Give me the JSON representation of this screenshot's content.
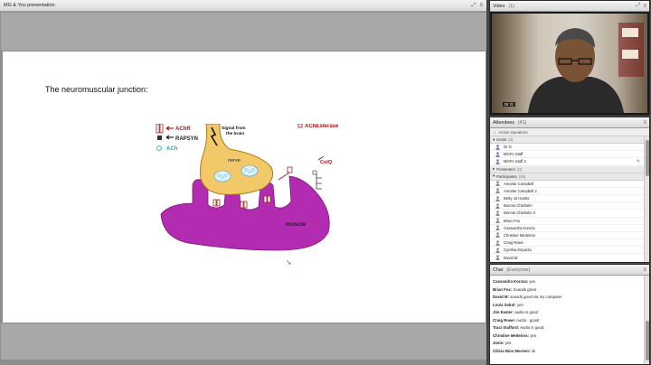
{
  "presentation": {
    "title": "MG & You presentation",
    "slide": {
      "heading": "The neuromuscular junction:",
      "labels": {
        "achr": "AChR",
        "rapsyn": "RAPSYN",
        "ach": "ACh",
        "signal_line1": "Signal from",
        "signal_line2": "the brain",
        "nerve": "nerve",
        "achesterase": "AChEsterase",
        "colq": "ColQ",
        "muscle": "muscle"
      },
      "colors": {
        "nerve_fill": "#f2c968",
        "muscle_fill": "#b22bb0",
        "label_red": "#b01010",
        "ach_cyan": "#20a8c8"
      }
    }
  },
  "video": {
    "title": "Video",
    "count": "(1)",
    "presenter_name": "Dr G"
  },
  "attendees": {
    "title": "Attendees",
    "count": "(41)",
    "active_speakers": "Active Speakers",
    "sections": {
      "hosts": {
        "label": "Hosts",
        "count": "(3)"
      },
      "presenters": {
        "label": "Presenters",
        "count": "(0)"
      },
      "participants": {
        "label": "Participants",
        "count": "(38)"
      }
    },
    "hosts": [
      "Dr G",
      "MGFA Staff",
      "MGFA Staff 2"
    ],
    "participants": [
      "Annette Campbell",
      "Annette Campbell 2",
      "Betty Jo Hanks",
      "Bonnie Chisholm",
      "Bonnie Chisholm 2",
      "Brian Fox",
      "Cassandra Koroza",
      "Christine Medeiros",
      "Craig Rowe",
      "Cynthia Esparza",
      "David M"
    ]
  },
  "chat": {
    "title": "Chat",
    "audience": "(Everyone)",
    "messages": [
      {
        "who": "Cassandra Koroza:",
        "text": "yes"
      },
      {
        "who": "Brian Fox:",
        "text": "Sounds great"
      },
      {
        "who": "David M:",
        "text": "sounds good via my computer"
      },
      {
        "who": "Louis Sokol:",
        "text": "yes"
      },
      {
        "who": "Jim Easter:",
        "text": "audio is good"
      },
      {
        "who": "Craig Rowe:",
        "text": "Audio - good!"
      },
      {
        "who": "Traci Stafford:",
        "text": "Audio is good"
      },
      {
        "who": "Christine Medeiros:",
        "text": "yes"
      },
      {
        "who": "Josie:",
        "text": "yes"
      },
      {
        "who": "Cilicia Rios Moreno:",
        "text": "ok"
      }
    ]
  }
}
